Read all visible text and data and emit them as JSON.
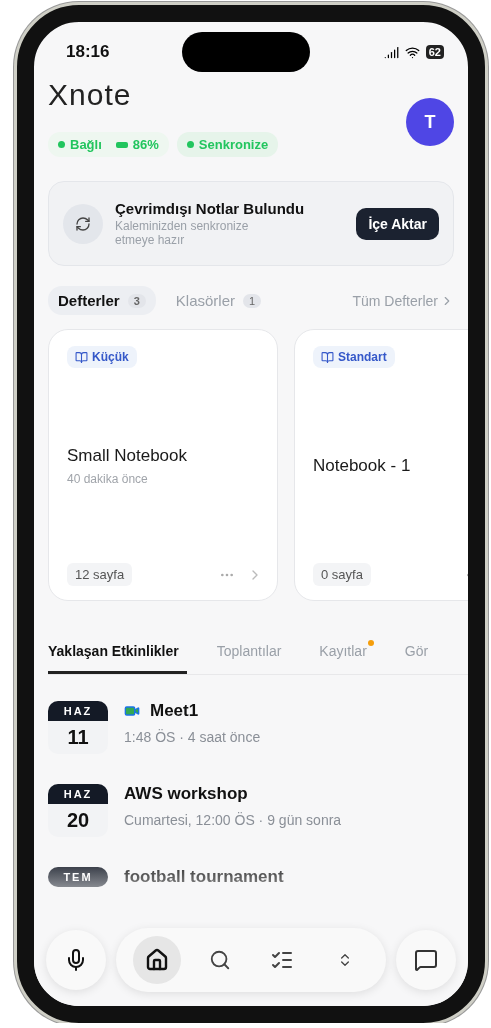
{
  "status_bar": {
    "time": "18:16",
    "battery": "62"
  },
  "app": {
    "logo": "Xnote",
    "avatar": "T"
  },
  "status_chips": [
    {
      "kind": "dot",
      "label": "Bağlı",
      "color": "#22c55e"
    },
    {
      "kind": "battery",
      "label": "86%",
      "color": "#22c55e"
    }
  ],
  "sync_chip": {
    "label": "Senkronize",
    "color": "#22c55e"
  },
  "offline_banner": {
    "title": "Çevrimdışı Notlar Bulundu",
    "subtitle": "Kaleminizden senkronize etmeye hazır",
    "button": "İçe Aktar"
  },
  "notebook_tabs": [
    {
      "label": "Defterler",
      "count": "3",
      "selected": true
    },
    {
      "label": "Klasörler",
      "count": "1",
      "selected": false
    }
  ],
  "all_link": "Tüm Defterler",
  "notebooks": [
    {
      "badge": "Küçük",
      "title": "Small Notebook",
      "subtitle": "40 dakika önce",
      "pages": "12 sayfa"
    },
    {
      "badge": "Standart",
      "title": "Notebook - 1",
      "pages": "0 sayfa"
    }
  ],
  "event_tabs": [
    {
      "label": "Yaklaşan Etkinlikler",
      "selected": true,
      "dot": false
    },
    {
      "label": "Toplantılar",
      "selected": false,
      "dot": false
    },
    {
      "label": "Kayıtlar",
      "selected": false,
      "dot": true
    },
    {
      "label": "Gör",
      "selected": false,
      "dot": false
    }
  ],
  "events": [
    {
      "month": "HAZ",
      "day": "11",
      "title": "Meet1",
      "subtitle": "1:48 ÖS · 4 saat önce",
      "video": true
    },
    {
      "month": "HAZ",
      "day": "20",
      "title": "AWS workshop",
      "subtitle": "Cumartesi, 12:00 ÖS · 9 gün sonra",
      "video": false
    },
    {
      "month": "TEM",
      "title": "football tournament",
      "video": false
    }
  ],
  "bottom_nav": {
    "items": [
      {
        "kind": "home",
        "selected": true
      },
      {
        "kind": "search",
        "selected": false
      },
      {
        "kind": "tasks",
        "selected": false
      },
      {
        "kind": "expand",
        "selected": false
      }
    ]
  }
}
